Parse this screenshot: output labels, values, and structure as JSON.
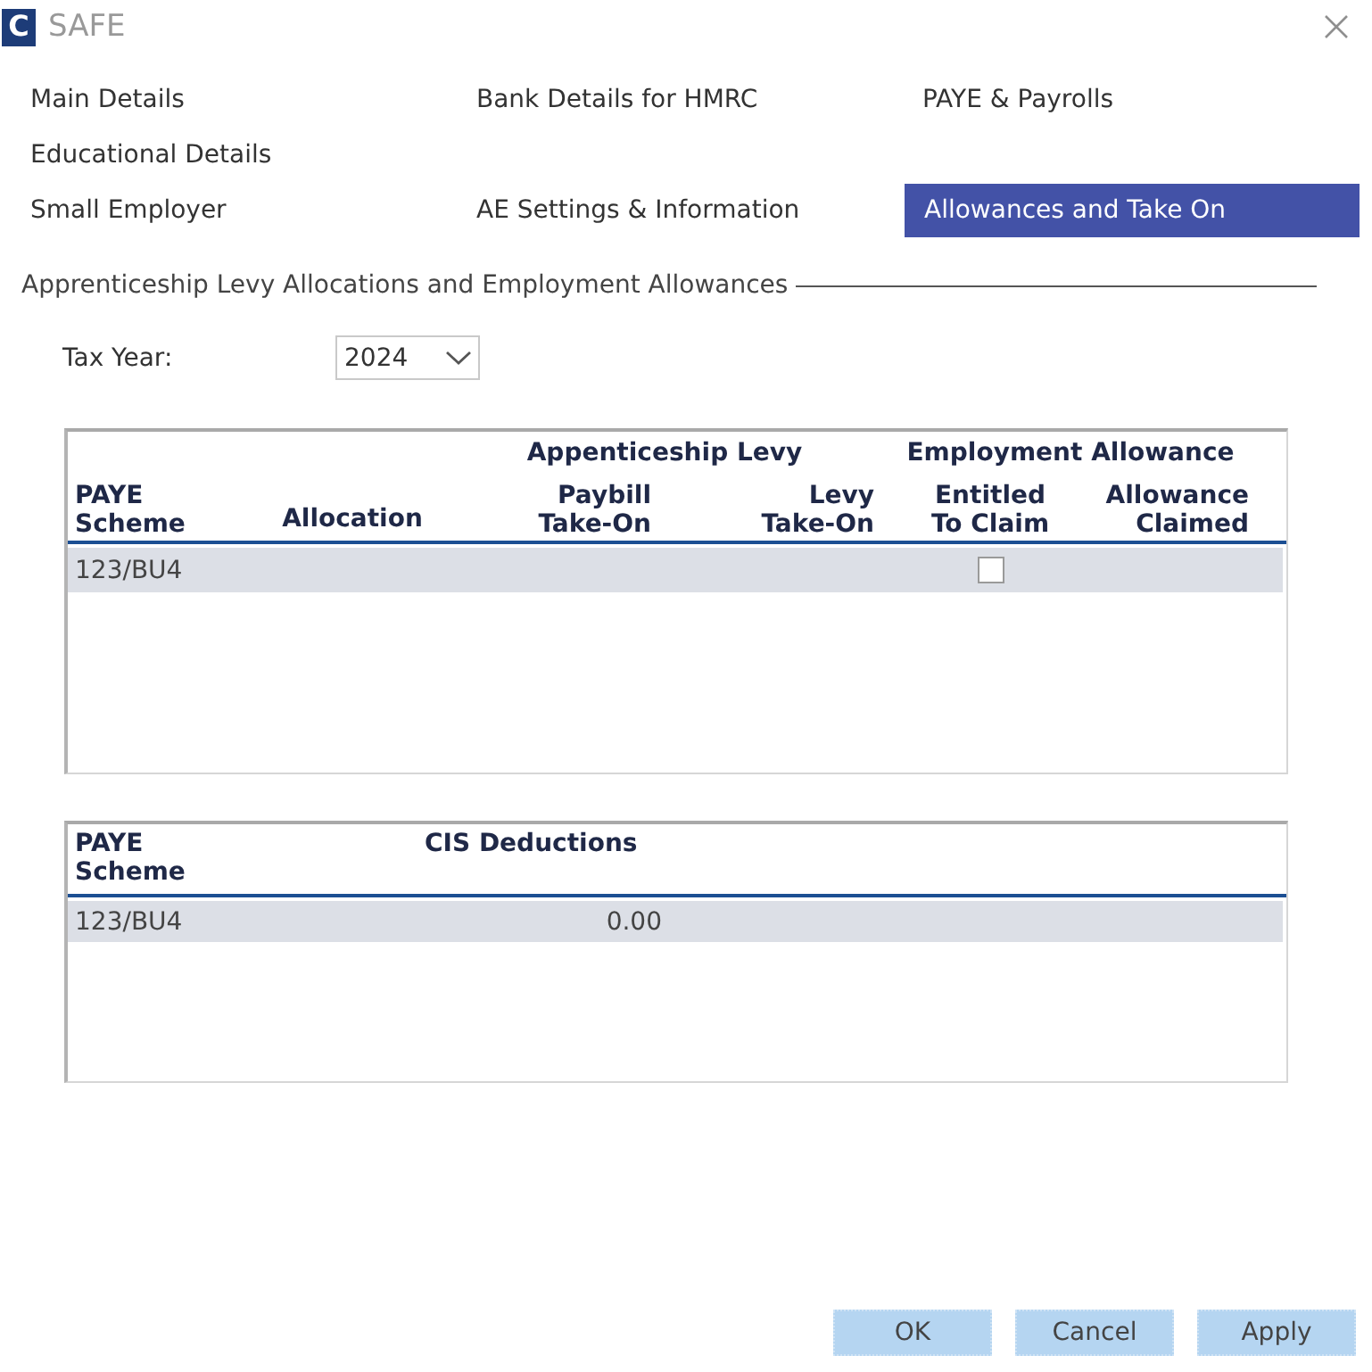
{
  "window": {
    "logo": "C",
    "title": "SAFE"
  },
  "tab_rows": [
    {
      "tabs": [
        {
          "label": "Main Details",
          "selected": false
        },
        {
          "label": "Bank Details for HMRC",
          "selected": false
        },
        {
          "label": "PAYE & Payrolls",
          "selected": false
        }
      ]
    },
    {
      "tabs": [
        {
          "label": "Educational Details",
          "selected": false
        }
      ]
    },
    {
      "tabs": [
        {
          "label": "Small Employer",
          "selected": false
        },
        {
          "label": "AE Settings & Information",
          "selected": false
        },
        {
          "label": "Allowances and Take On",
          "selected": true
        }
      ]
    }
  ],
  "section": {
    "title": "Apprenticeship Levy Allocations and Employment Allowances"
  },
  "tax_year": {
    "label": "Tax Year:",
    "value": "2024"
  },
  "levy_table": {
    "column_groups": [
      "Appenticeship Levy",
      "Employment Allowance"
    ],
    "columns": [
      "PAYE\nScheme",
      "Allocation",
      "Paybill\nTake-On",
      "Levy\nTake-On",
      "Entitled\nTo Claim",
      "Allowance\nClaimed"
    ],
    "rows": [
      {
        "paye_scheme": "123/BU4",
        "entitled_to_claim": {
          "checked": false
        }
      }
    ]
  },
  "cis_table": {
    "columns": [
      "PAYE\nScheme",
      "CIS Deductions"
    ],
    "rows": [
      {
        "paye_scheme": "123/BU4",
        "cis_deductions": "0.00"
      }
    ]
  },
  "buttons": [
    "OK",
    "Cancel",
    "Apply"
  ]
}
